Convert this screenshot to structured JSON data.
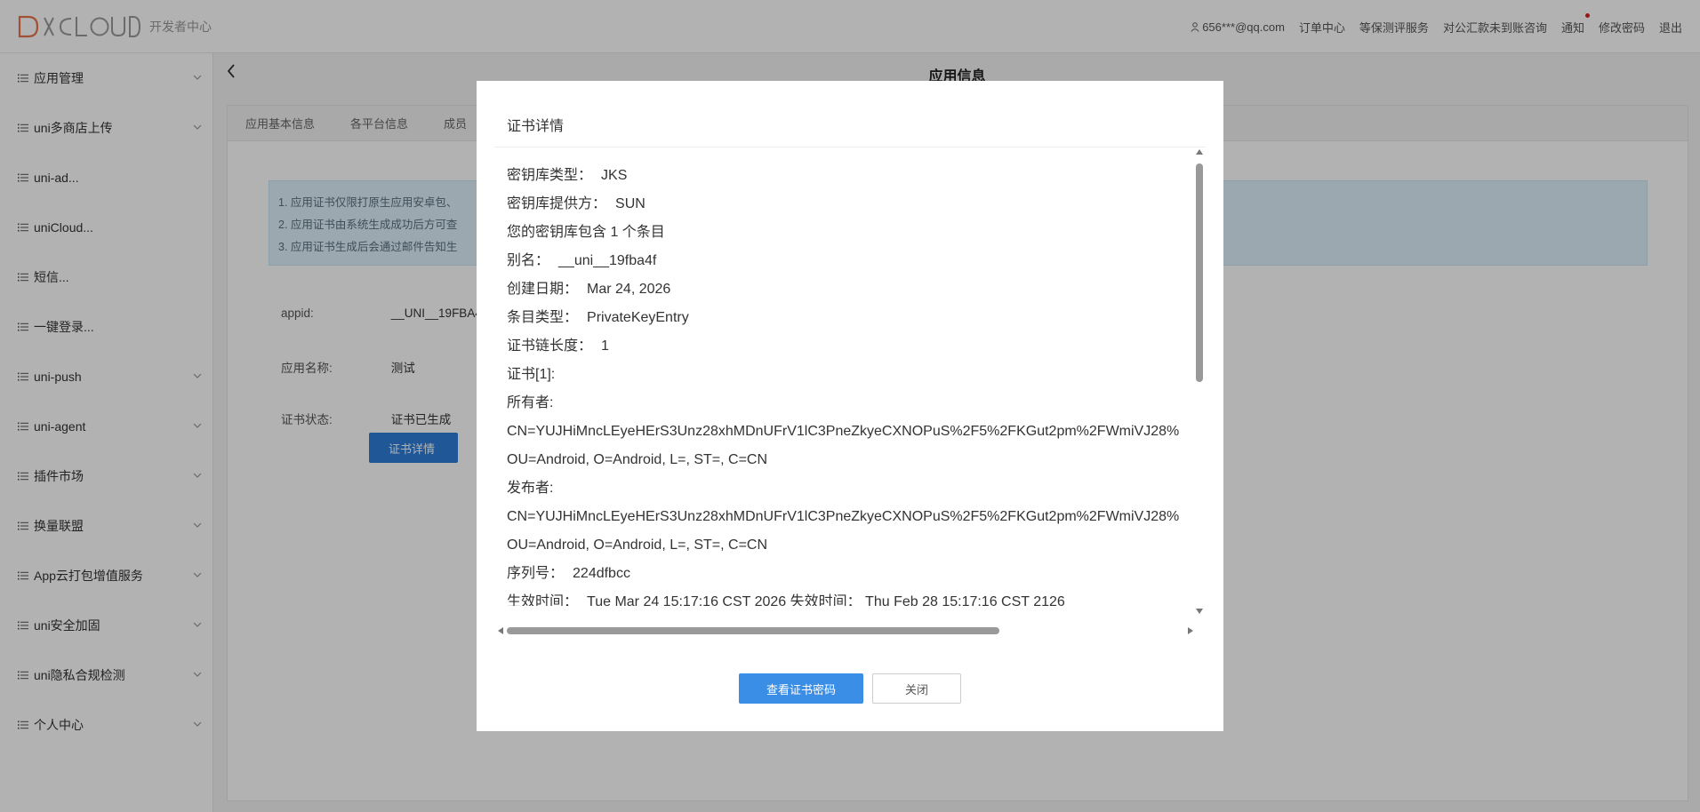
{
  "header": {
    "logo_text": "DCLOUD",
    "logo_sub": "开发者中心",
    "user_email": "656***@qq.com",
    "nav": [
      "订单中心",
      "等保测评服务",
      "对公汇款未到账咨询",
      "通知",
      "修改密码",
      "退出"
    ],
    "notification_dot_color": "#e02020"
  },
  "sidebar": {
    "items": [
      {
        "label": "应用管理",
        "expandable": true
      },
      {
        "label": "uni多商店上传",
        "expandable": true
      },
      {
        "label": "uni-ad...",
        "expandable": false
      },
      {
        "label": "uniCloud...",
        "expandable": false
      },
      {
        "label": "短信...",
        "expandable": false
      },
      {
        "label": "一键登录...",
        "expandable": false
      },
      {
        "label": "uni-push",
        "expandable": true
      },
      {
        "label": "uni-agent",
        "expandable": true
      },
      {
        "label": "插件市场",
        "expandable": true
      },
      {
        "label": "换量联盟",
        "expandable": true
      },
      {
        "label": "App云打包增值服务",
        "expandable": true
      },
      {
        "label": "uni安全加固",
        "expandable": true
      },
      {
        "label": "uni隐私合规检测",
        "expandable": true
      },
      {
        "label": "个人中心",
        "expandable": true
      }
    ]
  },
  "main": {
    "page_title": "应用信息",
    "tabs": [
      "应用基本信息",
      "各平台信息",
      "成员"
    ],
    "notice_lines": [
      "1. 应用证书仅限打原生应用安卓包、",
      "2. 应用证书由系统生成成功后方可查",
      "3. 应用证书生成后会通过邮件告知生"
    ],
    "fields": [
      {
        "label": "appid:",
        "value": "__UNI__19FBA4"
      },
      {
        "label": "应用名称:",
        "value": "测试"
      },
      {
        "label": "证书状态:",
        "value": "证书已生成"
      }
    ],
    "detail_button": "证书详情"
  },
  "modal": {
    "title": "证书详情",
    "lines": [
      {
        "k": "密钥库类型：",
        "v": "JKS"
      },
      {
        "k": "密钥库提供方：",
        "v": "SUN"
      },
      {
        "k": "",
        "v": "您的密钥库包含 1 个条目"
      },
      {
        "k": "别名：",
        "v": "__uni__19fba4f"
      },
      {
        "k": "创建日期：",
        "v": "Mar 24, 2026"
      },
      {
        "k": "条目类型：",
        "v": "PrivateKeyEntry"
      },
      {
        "k": "证书链长度：",
        "v": "1"
      },
      {
        "k": "",
        "v": "证书[1]:"
      },
      {
        "k": "",
        "v": "所有者:"
      },
      {
        "k": "",
        "v": "CN=YUJHiMncLEyeHErS3Unz28xhMDnUFrV1lC3PneZkyeCXNOPuS%2F5%2FKGut2pm%2FWmiVJ28%"
      },
      {
        "k": "",
        "v": "OU=Android, O=Android, L=, ST=, C=CN"
      },
      {
        "k": "",
        "v": "发布者:"
      },
      {
        "k": "",
        "v": "CN=YUJHiMncLEyeHErS3Unz28xhMDnUFrV1lC3PneZkyeCXNOPuS%2F5%2FKGut2pm%2FWmiVJ28%"
      },
      {
        "k": "",
        "v": "OU=Android, O=Android, L=, ST=, C=CN"
      },
      {
        "k": "序列号：",
        "v": "224dfbcc"
      },
      {
        "k": "生效时间：",
        "v": "Tue Mar 24 15:17:16 CST 2026 失效时间： Thu Feb 28 15:17:16 CST 2126"
      }
    ],
    "btn_view_password": "查看证书密码",
    "btn_close": "关闭"
  },
  "colors": {
    "primary": "#3a8ee6",
    "logo_orange": "#e8734a",
    "logo_gray": "#9a9a9a"
  }
}
